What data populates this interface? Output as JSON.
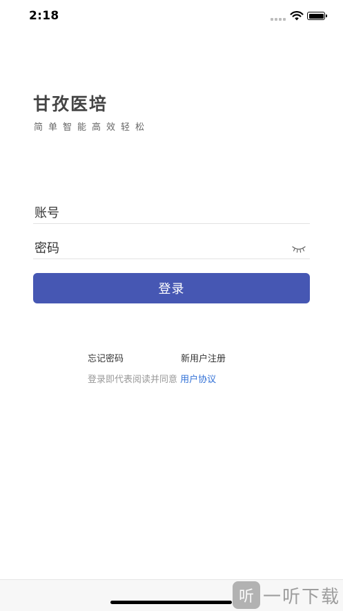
{
  "status_bar": {
    "time": "2:18",
    "signal_icon": "cellular-signal-icon",
    "wifi_icon": "wifi-icon",
    "battery_icon": "battery-full-icon"
  },
  "header": {
    "title": "甘孜医培",
    "slogan": "简单智能高效轻松"
  },
  "form": {
    "account_placeholder": "账号",
    "password_placeholder": "密码",
    "password_toggle_icon": "eye-closed-icon",
    "login_label": "登录"
  },
  "links": {
    "forgot_password": "忘记密码",
    "register": "新用户注册"
  },
  "agreement": {
    "prefix": "登录即代表阅读并同意 ",
    "link_label": "用户协议"
  },
  "watermark": {
    "logo_glyph": "听",
    "text": "一听下载"
  },
  "colors": {
    "primary_button": "#4657b3",
    "link_blue": "#2f6fd6",
    "title_text": "#444444",
    "muted_text": "#999999"
  }
}
